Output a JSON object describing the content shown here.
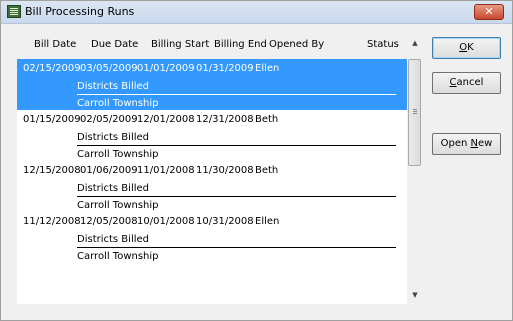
{
  "window": {
    "title": "Bill Processing Runs",
    "close_label": "✕"
  },
  "columns": {
    "bill_date": "Bill Date",
    "due_date": "Due Date",
    "billing_start": "Billing Start",
    "billing_end": "Billing End",
    "opened_by": "Opened By",
    "status": "Status"
  },
  "runs": [
    {
      "bill_date": "02/15/2009",
      "due_date": "03/05/2009",
      "billing_start": "01/01/2009",
      "billing_end": "01/31/2009",
      "opened_by": "Ellen",
      "status": "",
      "districts_label": "Districts Billed",
      "district": "Carroll Township",
      "selected": true
    },
    {
      "bill_date": "01/15/2009",
      "due_date": "02/05/2009",
      "billing_start": "12/01/2008",
      "billing_end": "12/31/2008",
      "opened_by": "Beth",
      "status": "",
      "districts_label": "Districts Billed",
      "district": "Carroll Township",
      "selected": false
    },
    {
      "bill_date": "12/15/2008",
      "due_date": "01/06/2009",
      "billing_start": "11/01/2008",
      "billing_end": "11/30/2008",
      "opened_by": "Beth",
      "status": "",
      "districts_label": "Districts Billed",
      "district": "Carroll Township",
      "selected": false
    },
    {
      "bill_date": "11/12/2008",
      "due_date": "12/05/2008",
      "billing_start": "10/01/2008",
      "billing_end": "10/31/2008",
      "opened_by": "Ellen",
      "status": "",
      "districts_label": "Districts Billed",
      "district": "Carroll Township",
      "selected": false
    }
  ],
  "buttons": {
    "ok_prefix": "",
    "ok_mnemonic": "O",
    "ok_rest": "K",
    "cancel_mnemonic": "C",
    "cancel_rest": "ancel",
    "open_new_prefix": "Open ",
    "open_new_mnemonic": "N",
    "open_new_rest": "ew"
  },
  "scrollbar": {
    "up_icon": "▲",
    "down_icon": "▼"
  },
  "colors": {
    "selection": "#3399ff",
    "titlebar": "#c9d9ee",
    "close_button": "#c9472d"
  }
}
